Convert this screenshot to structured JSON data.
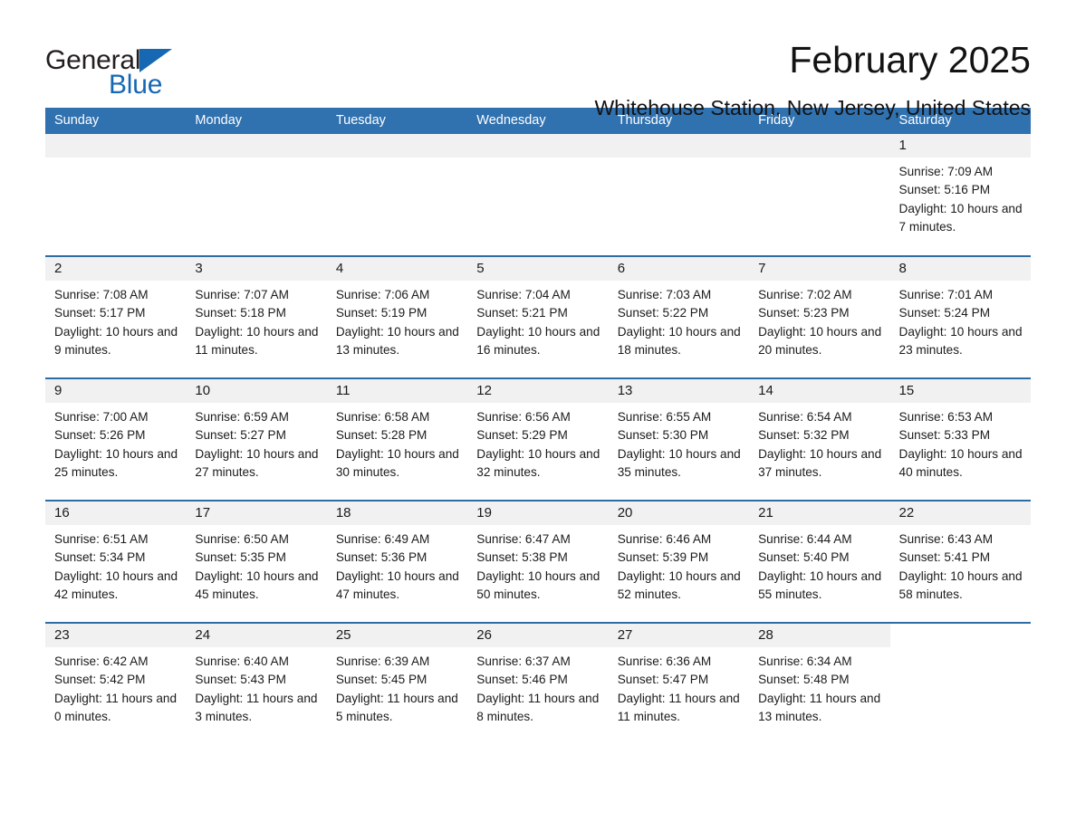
{
  "brand": {
    "name_part1": "General",
    "name_part2": "Blue",
    "accent_color": "#1668b3",
    "triangle_icon": "brand-triangle-icon"
  },
  "header": {
    "title": "February 2025",
    "subtitle": "Whitehouse Station, New Jersey, United States"
  },
  "calendar": {
    "header_bg": "#3071b0",
    "header_text_color": "#ffffff",
    "row_divider_color": "#2e6da4",
    "daynum_bg": "#f1f1f1",
    "weekdays": [
      "Sunday",
      "Monday",
      "Tuesday",
      "Wednesday",
      "Thursday",
      "Friday",
      "Saturday"
    ],
    "weeks": [
      [
        {
          "day": "",
          "lines": []
        },
        {
          "day": "",
          "lines": []
        },
        {
          "day": "",
          "lines": []
        },
        {
          "day": "",
          "lines": []
        },
        {
          "day": "",
          "lines": []
        },
        {
          "day": "",
          "lines": []
        },
        {
          "day": "1",
          "lines": [
            "Sunrise: 7:09 AM",
            "Sunset: 5:16 PM",
            "Daylight: 10 hours and 7 minutes."
          ]
        }
      ],
      [
        {
          "day": "2",
          "lines": [
            "Sunrise: 7:08 AM",
            "Sunset: 5:17 PM",
            "Daylight: 10 hours and 9 minutes."
          ]
        },
        {
          "day": "3",
          "lines": [
            "Sunrise: 7:07 AM",
            "Sunset: 5:18 PM",
            "Daylight: 10 hours and 11 minutes."
          ]
        },
        {
          "day": "4",
          "lines": [
            "Sunrise: 7:06 AM",
            "Sunset: 5:19 PM",
            "Daylight: 10 hours and 13 minutes."
          ]
        },
        {
          "day": "5",
          "lines": [
            "Sunrise: 7:04 AM",
            "Sunset: 5:21 PM",
            "Daylight: 10 hours and 16 minutes."
          ]
        },
        {
          "day": "6",
          "lines": [
            "Sunrise: 7:03 AM",
            "Sunset: 5:22 PM",
            "Daylight: 10 hours and 18 minutes."
          ]
        },
        {
          "day": "7",
          "lines": [
            "Sunrise: 7:02 AM",
            "Sunset: 5:23 PM",
            "Daylight: 10 hours and 20 minutes."
          ]
        },
        {
          "day": "8",
          "lines": [
            "Sunrise: 7:01 AM",
            "Sunset: 5:24 PM",
            "Daylight: 10 hours and 23 minutes."
          ]
        }
      ],
      [
        {
          "day": "9",
          "lines": [
            "Sunrise: 7:00 AM",
            "Sunset: 5:26 PM",
            "Daylight: 10 hours and 25 minutes."
          ]
        },
        {
          "day": "10",
          "lines": [
            "Sunrise: 6:59 AM",
            "Sunset: 5:27 PM",
            "Daylight: 10 hours and 27 minutes."
          ]
        },
        {
          "day": "11",
          "lines": [
            "Sunrise: 6:58 AM",
            "Sunset: 5:28 PM",
            "Daylight: 10 hours and 30 minutes."
          ]
        },
        {
          "day": "12",
          "lines": [
            "Sunrise: 6:56 AM",
            "Sunset: 5:29 PM",
            "Daylight: 10 hours and 32 minutes."
          ]
        },
        {
          "day": "13",
          "lines": [
            "Sunrise: 6:55 AM",
            "Sunset: 5:30 PM",
            "Daylight: 10 hours and 35 minutes."
          ]
        },
        {
          "day": "14",
          "lines": [
            "Sunrise: 6:54 AM",
            "Sunset: 5:32 PM",
            "Daylight: 10 hours and 37 minutes."
          ]
        },
        {
          "day": "15",
          "lines": [
            "Sunrise: 6:53 AM",
            "Sunset: 5:33 PM",
            "Daylight: 10 hours and 40 minutes."
          ]
        }
      ],
      [
        {
          "day": "16",
          "lines": [
            "Sunrise: 6:51 AM",
            "Sunset: 5:34 PM",
            "Daylight: 10 hours and 42 minutes."
          ]
        },
        {
          "day": "17",
          "lines": [
            "Sunrise: 6:50 AM",
            "Sunset: 5:35 PM",
            "Daylight: 10 hours and 45 minutes."
          ]
        },
        {
          "day": "18",
          "lines": [
            "Sunrise: 6:49 AM",
            "Sunset: 5:36 PM",
            "Daylight: 10 hours and 47 minutes."
          ]
        },
        {
          "day": "19",
          "lines": [
            "Sunrise: 6:47 AM",
            "Sunset: 5:38 PM",
            "Daylight: 10 hours and 50 minutes."
          ]
        },
        {
          "day": "20",
          "lines": [
            "Sunrise: 6:46 AM",
            "Sunset: 5:39 PM",
            "Daylight: 10 hours and 52 minutes."
          ]
        },
        {
          "day": "21",
          "lines": [
            "Sunrise: 6:44 AM",
            "Sunset: 5:40 PM",
            "Daylight: 10 hours and 55 minutes."
          ]
        },
        {
          "day": "22",
          "lines": [
            "Sunrise: 6:43 AM",
            "Sunset: 5:41 PM",
            "Daylight: 10 hours and 58 minutes."
          ]
        }
      ],
      [
        {
          "day": "23",
          "lines": [
            "Sunrise: 6:42 AM",
            "Sunset: 5:42 PM",
            "Daylight: 11 hours and 0 minutes."
          ]
        },
        {
          "day": "24",
          "lines": [
            "Sunrise: 6:40 AM",
            "Sunset: 5:43 PM",
            "Daylight: 11 hours and 3 minutes."
          ]
        },
        {
          "day": "25",
          "lines": [
            "Sunrise: 6:39 AM",
            "Sunset: 5:45 PM",
            "Daylight: 11 hours and 5 minutes."
          ]
        },
        {
          "day": "26",
          "lines": [
            "Sunrise: 6:37 AM",
            "Sunset: 5:46 PM",
            "Daylight: 11 hours and 8 minutes."
          ]
        },
        {
          "day": "27",
          "lines": [
            "Sunrise: 6:36 AM",
            "Sunset: 5:47 PM",
            "Daylight: 11 hours and 11 minutes."
          ]
        },
        {
          "day": "28",
          "lines": [
            "Sunrise: 6:34 AM",
            "Sunset: 5:48 PM",
            "Daylight: 11 hours and 13 minutes."
          ]
        },
        {
          "day": "",
          "lines": []
        }
      ]
    ]
  }
}
